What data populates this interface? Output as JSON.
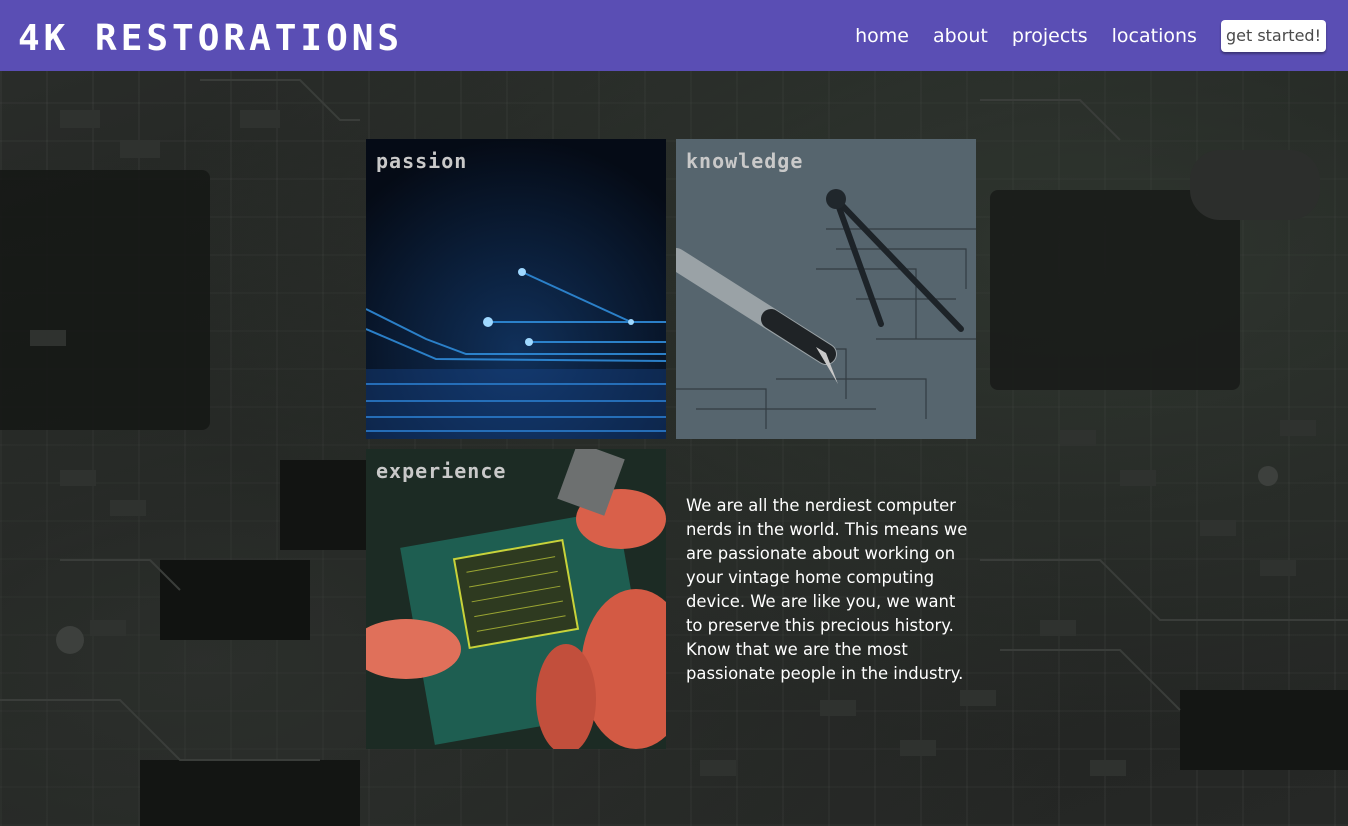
{
  "header": {
    "logo": "4K RESTORATIONS",
    "nav": [
      {
        "label": "home"
      },
      {
        "label": "about"
      },
      {
        "label": "projects"
      },
      {
        "label": "locations"
      }
    ],
    "cta_label": "get started!",
    "background_color": "#5a4eb4"
  },
  "tiles": [
    {
      "label": "passion",
      "image": "glowing-circuit-lines"
    },
    {
      "label": "knowledge",
      "image": "fountain-pen-and-compass-on-schematic"
    },
    {
      "label": "experience",
      "image": "hands-inserting-chip"
    }
  ],
  "about": {
    "text": "We are all the nerdiest computer nerds in the world. This means we are passionate about working on your vintage home computing device. We are like you, we want to preserve this precious history. Know that we are the most passionate people in the industry."
  }
}
